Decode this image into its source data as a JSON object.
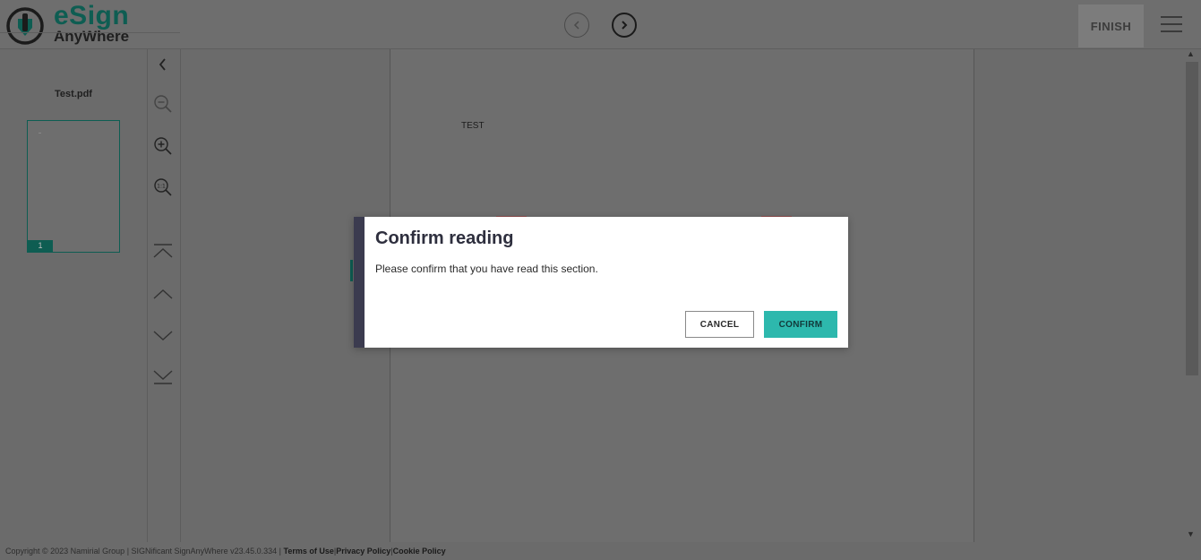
{
  "header": {
    "logo_primary": "eSign",
    "logo_secondary": "AnyWhere",
    "finish_label": "FINISH",
    "prev_icon": "chevron-left-circle-icon",
    "next_icon": "chevron-right-circle-icon",
    "menu_icon": "hamburger-menu-icon"
  },
  "sidebar": {
    "file_name": "Test.pdf",
    "page_number": "1",
    "collapse_icon": "chevron-left-icon",
    "tools": [
      "zoom-out-icon",
      "zoom-in-icon",
      "zoom-reset-icon",
      "first-page-icon",
      "previous-page-icon",
      "next-page-icon",
      "last-page-icon"
    ]
  },
  "document": {
    "text": "TEST"
  },
  "modal": {
    "title": "Confirm reading",
    "message": "Please confirm that you have read this section.",
    "cancel_label": "CANCEL",
    "confirm_label": "CONFIRM"
  },
  "footer": {
    "copyright": "Copyright © 2023 Namirial Group | SIGNificant SignAnyWhere v23.45.0.334 |",
    "terms": "Terms of Use",
    "privacy": "Privacy Policy",
    "cookie": "Cookie Policy",
    "sep": "|"
  },
  "colors": {
    "brand": "#0e5d52",
    "confirm": "#2db8ad",
    "modal_accent": "#3b3b4f"
  }
}
